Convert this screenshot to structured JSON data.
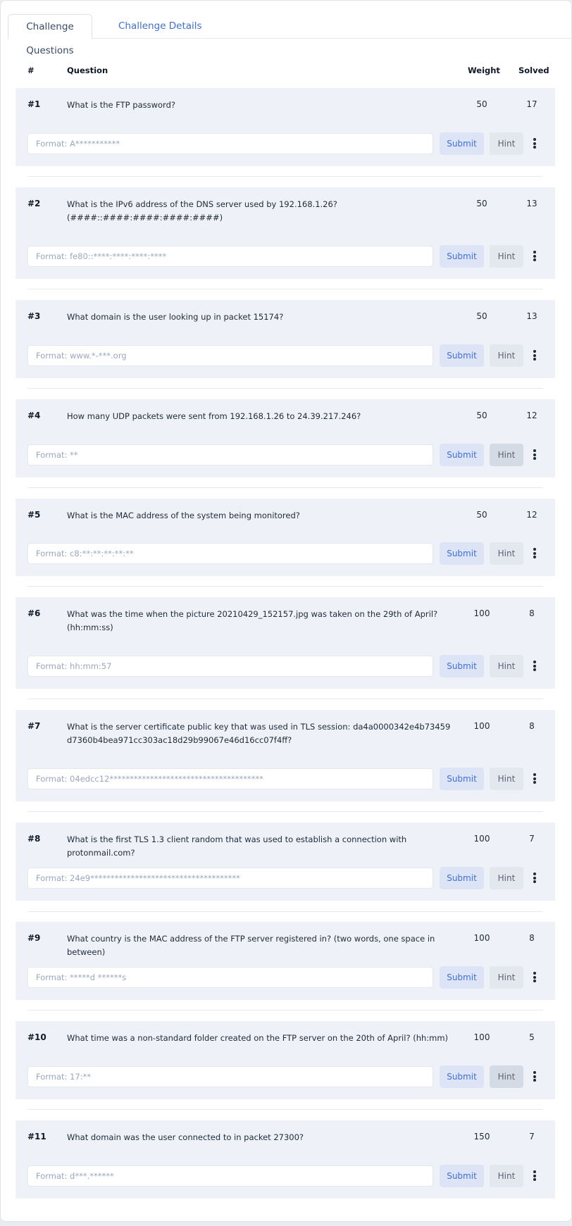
{
  "tabs": [
    {
      "label": "Challenge Questions",
      "active": true
    },
    {
      "label": "Challenge Details",
      "active": false
    }
  ],
  "table": {
    "headers": {
      "num": "#",
      "question": "Question",
      "weight": "Weight",
      "solved": "Solved"
    },
    "submit_label": "Submit",
    "hint_label": "Hint",
    "rows": [
      {
        "num": "#1",
        "question": "What is the FTP password?",
        "weight": "50",
        "solved": "17",
        "placeholder": "Format: A***********"
      },
      {
        "num": "#2",
        "question": "What is the IPv6 address of the DNS server used by 192.168.1.26? (####::####:####:####:####)",
        "weight": "50",
        "solved": "13",
        "placeholder": "Format: fe80::****:****:****:****"
      },
      {
        "num": "#3",
        "question": "What domain is the user looking up in packet 15174?",
        "weight": "50",
        "solved": "13",
        "placeholder": "Format: www.*-***.org"
      },
      {
        "num": "#4",
        "question": "How many UDP packets were sent from 192.168.1.26 to 24.39.217.246?",
        "weight": "50",
        "solved": "12",
        "placeholder": "Format: **"
      },
      {
        "num": "#5",
        "question": "What is the MAC address of the system being monitored?",
        "weight": "50",
        "solved": "12",
        "placeholder": "Format: c8:**:**:**:**:**"
      },
      {
        "num": "#6",
        "question": "What was the time when the picture 20210429_152157.jpg was taken on the 29th of April? (hh:mm:ss)",
        "weight": "100",
        "solved": "8",
        "placeholder": "Format: hh:mm:57"
      },
      {
        "num": "#7",
        "question": "What is the server certificate public key that was used in TLS session: da4a0000342e4b73459d7360b4bea971cc303ac18d29b99067e46d16cc07f4ff?",
        "weight": "100",
        "solved": "8",
        "placeholder": "Format: 04edcc12**************************************"
      },
      {
        "num": "#8",
        "question": "What is the first TLS 1.3 client random that was used to establish a connection with protonmail.com?",
        "weight": "100",
        "solved": "7",
        "placeholder": "Format: 24e9*************************************"
      },
      {
        "num": "#9",
        "question": "What country is the MAC address of the FTP server registered in? (two words, one space in between)",
        "weight": "100",
        "solved": "8",
        "placeholder": "Format: *****d ******s"
      },
      {
        "num": "#10",
        "question": "What time was a non-standard folder created on the FTP server on the 20th of April? (hh:mm)",
        "weight": "100",
        "solved": "5",
        "placeholder": "Format: 17:**"
      },
      {
        "num": "#11",
        "question": "What domain was the user connected to in packet 27300?",
        "weight": "150",
        "solved": "7",
        "placeholder": "Format: d***.******"
      }
    ]
  }
}
